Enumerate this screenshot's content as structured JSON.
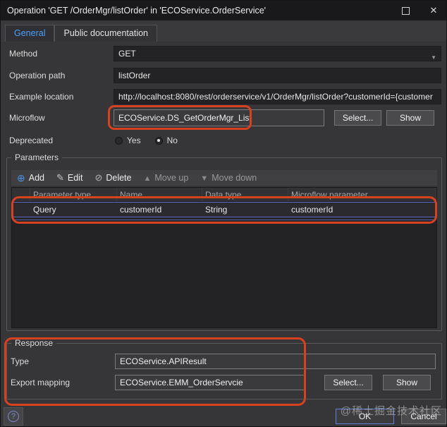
{
  "window": {
    "title": "Operation 'GET /OrderMgr/listOrder' in 'ECOService.OrderService'"
  },
  "tabs": [
    {
      "label": "General",
      "active": true
    },
    {
      "label": "Public documentation",
      "active": false
    }
  ],
  "form": {
    "method": {
      "label": "Method",
      "value": "GET"
    },
    "operation_path": {
      "label": "Operation path",
      "value": "listOrder"
    },
    "example_location": {
      "label": "Example location",
      "value": "http://localhost:8080/rest/orderservice/v1/OrderMgr/listOrder?customerId={customer"
    },
    "microflow": {
      "label": "Microflow",
      "value": "ECOService.DS_GetOrderMgr_List",
      "select_button": "Select...",
      "show_button": "Show"
    },
    "deprecated": {
      "label": "Deprecated",
      "options": [
        {
          "label": "Yes",
          "selected": false
        },
        {
          "label": "No",
          "selected": true
        }
      ]
    }
  },
  "parameters": {
    "group_label": "Parameters",
    "toolbar": [
      {
        "label": "Add",
        "icon": "add-circle-icon"
      },
      {
        "label": "Edit",
        "icon": "pencil-icon"
      },
      {
        "label": "Delete",
        "icon": "no-entry-icon"
      },
      {
        "label": "Move up",
        "icon": "triangle-up-icon",
        "disabled": true
      },
      {
        "label": "Move down",
        "icon": "triangle-down-icon",
        "disabled": true
      }
    ],
    "table": {
      "columns": [
        "Parameter type",
        "Name",
        "Data type",
        "Microflow parameter"
      ],
      "rows": [
        [
          "Query",
          "customerId",
          "String",
          "customerId"
        ]
      ],
      "selected_row_index": 0
    }
  },
  "response": {
    "group_label": "Response",
    "type": {
      "label": "Type",
      "value": "ECOService.APIResult"
    },
    "export_mapping": {
      "label": "Export mapping",
      "value": "ECOService.EMM_OrderServcie",
      "select_button": "Select...",
      "show_button": "Show"
    }
  },
  "footer": {
    "ok_label": "OK",
    "cancel_label": "Cancel",
    "watermark": "@稀土掘金技术社区"
  },
  "colors": {
    "annotation_red": "#d6411f",
    "accent_blue": "#4aa0f8",
    "selection_blue": "#5c6cc2",
    "dialog_bg": "#363638",
    "titlebar_bg": "#19191b"
  }
}
